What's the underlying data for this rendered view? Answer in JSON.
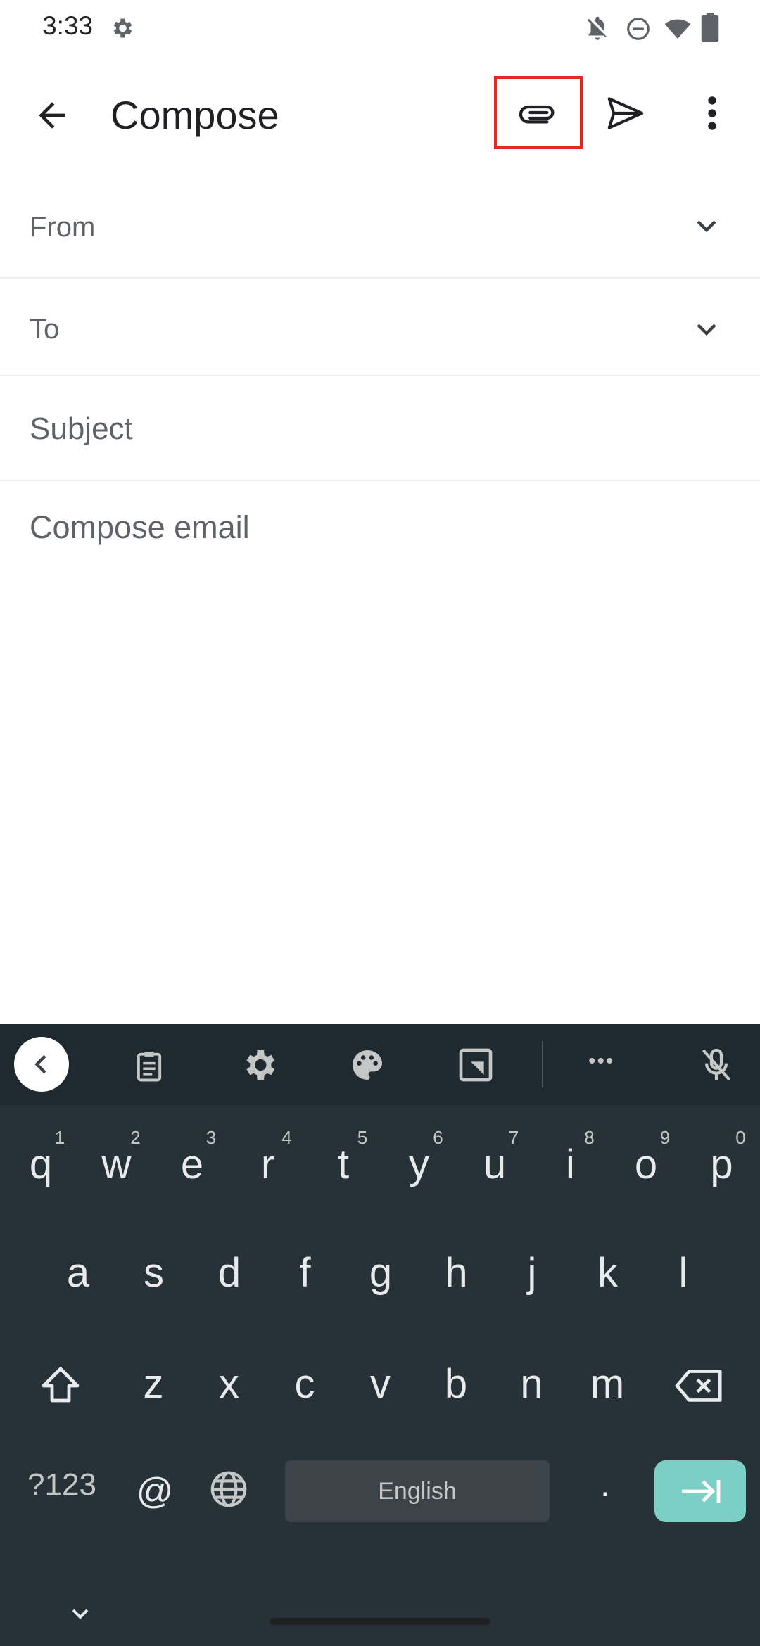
{
  "status_bar": {
    "time": "3:33"
  },
  "app_bar": {
    "title": "Compose"
  },
  "fields": {
    "from_label": "From",
    "to_label": "To",
    "subject_placeholder": "Subject",
    "body_placeholder": "Compose email"
  },
  "keyboard": {
    "row1": [
      "q",
      "w",
      "e",
      "r",
      "t",
      "y",
      "u",
      "i",
      "o",
      "p"
    ],
    "row1_hints": [
      "1",
      "2",
      "3",
      "4",
      "5",
      "6",
      "7",
      "8",
      "9",
      "0"
    ],
    "row2": [
      "a",
      "s",
      "d",
      "f",
      "g",
      "h",
      "j",
      "k",
      "l"
    ],
    "row3": [
      "z",
      "x",
      "c",
      "v",
      "b",
      "n",
      "m"
    ],
    "symbols_key": "?123",
    "at_key": "@",
    "space_label": "English",
    "period_key": ".",
    "toolbar_more": "•••"
  },
  "colors": {
    "highlight": "#e8261c",
    "keyboard_bg": "#263238",
    "enter_key": "#7ccfc4"
  }
}
